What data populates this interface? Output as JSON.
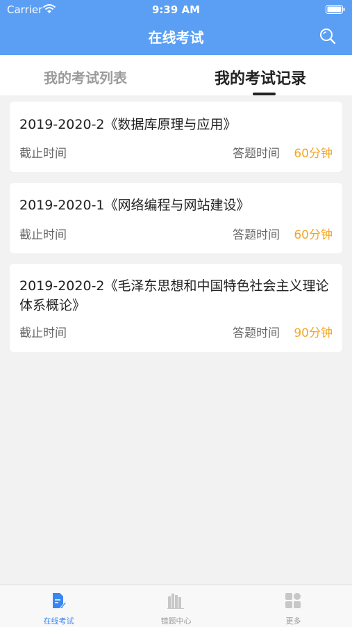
{
  "status": {
    "carrier": "Carrier",
    "time": "9:39 AM"
  },
  "header": {
    "title": "在线考试"
  },
  "tabs": [
    {
      "label": "我的考试列表"
    },
    {
      "label": "我的考试记录"
    }
  ],
  "exams": [
    {
      "title": "2019-2020-2《数据库原理与应用》",
      "deadline_label": "截止时间",
      "duration_label": "答题时间",
      "duration": "60分钟"
    },
    {
      "title": "2019-2020-1《网络编程与网站建设》",
      "deadline_label": "截止时间",
      "duration_label": "答题时间",
      "duration": "60分钟"
    },
    {
      "title": "2019-2020-2《毛泽东思想和中国特色社会主义理论体系概论》",
      "deadline_label": "截止时间",
      "duration_label": "答题时间",
      "duration": "90分钟"
    }
  ],
  "tabbar": [
    {
      "label": "在线考试",
      "icon": "exam-doc-icon"
    },
    {
      "label": "错题中心",
      "icon": "books-icon"
    },
    {
      "label": "更多",
      "icon": "grid-icon"
    }
  ],
  "colors": {
    "primary": "#5b9ff4",
    "accent": "#f5a623",
    "tab_active": "#3a86f0"
  }
}
